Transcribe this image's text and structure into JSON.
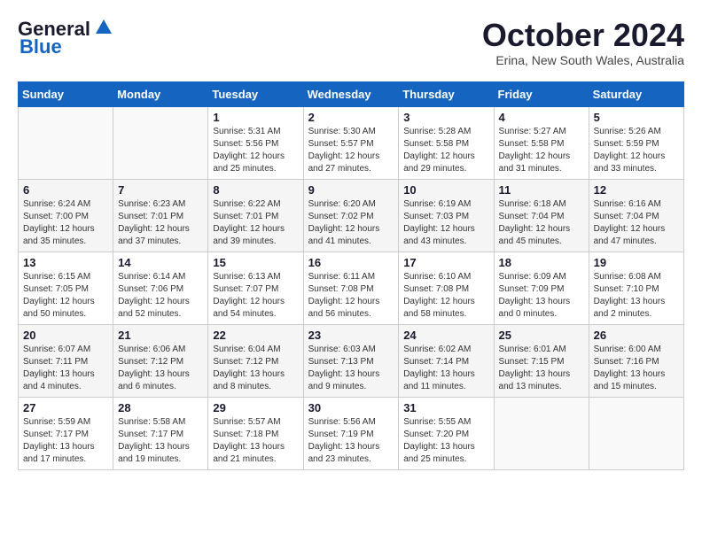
{
  "header": {
    "logo_general": "General",
    "logo_blue": "Blue",
    "month": "October 2024",
    "location": "Erina, New South Wales, Australia"
  },
  "days_of_week": [
    "Sunday",
    "Monday",
    "Tuesday",
    "Wednesday",
    "Thursday",
    "Friday",
    "Saturday"
  ],
  "weeks": [
    [
      {
        "day": "",
        "info": ""
      },
      {
        "day": "",
        "info": ""
      },
      {
        "day": "1",
        "info": "Sunrise: 5:31 AM\nSunset: 5:56 PM\nDaylight: 12 hours\nand 25 minutes."
      },
      {
        "day": "2",
        "info": "Sunrise: 5:30 AM\nSunset: 5:57 PM\nDaylight: 12 hours\nand 27 minutes."
      },
      {
        "day": "3",
        "info": "Sunrise: 5:28 AM\nSunset: 5:58 PM\nDaylight: 12 hours\nand 29 minutes."
      },
      {
        "day": "4",
        "info": "Sunrise: 5:27 AM\nSunset: 5:58 PM\nDaylight: 12 hours\nand 31 minutes."
      },
      {
        "day": "5",
        "info": "Sunrise: 5:26 AM\nSunset: 5:59 PM\nDaylight: 12 hours\nand 33 minutes."
      }
    ],
    [
      {
        "day": "6",
        "info": "Sunrise: 6:24 AM\nSunset: 7:00 PM\nDaylight: 12 hours\nand 35 minutes."
      },
      {
        "day": "7",
        "info": "Sunrise: 6:23 AM\nSunset: 7:01 PM\nDaylight: 12 hours\nand 37 minutes."
      },
      {
        "day": "8",
        "info": "Sunrise: 6:22 AM\nSunset: 7:01 PM\nDaylight: 12 hours\nand 39 minutes."
      },
      {
        "day": "9",
        "info": "Sunrise: 6:20 AM\nSunset: 7:02 PM\nDaylight: 12 hours\nand 41 minutes."
      },
      {
        "day": "10",
        "info": "Sunrise: 6:19 AM\nSunset: 7:03 PM\nDaylight: 12 hours\nand 43 minutes."
      },
      {
        "day": "11",
        "info": "Sunrise: 6:18 AM\nSunset: 7:04 PM\nDaylight: 12 hours\nand 45 minutes."
      },
      {
        "day": "12",
        "info": "Sunrise: 6:16 AM\nSunset: 7:04 PM\nDaylight: 12 hours\nand 47 minutes."
      }
    ],
    [
      {
        "day": "13",
        "info": "Sunrise: 6:15 AM\nSunset: 7:05 PM\nDaylight: 12 hours\nand 50 minutes."
      },
      {
        "day": "14",
        "info": "Sunrise: 6:14 AM\nSunset: 7:06 PM\nDaylight: 12 hours\nand 52 minutes."
      },
      {
        "day": "15",
        "info": "Sunrise: 6:13 AM\nSunset: 7:07 PM\nDaylight: 12 hours\nand 54 minutes."
      },
      {
        "day": "16",
        "info": "Sunrise: 6:11 AM\nSunset: 7:08 PM\nDaylight: 12 hours\nand 56 minutes."
      },
      {
        "day": "17",
        "info": "Sunrise: 6:10 AM\nSunset: 7:08 PM\nDaylight: 12 hours\nand 58 minutes."
      },
      {
        "day": "18",
        "info": "Sunrise: 6:09 AM\nSunset: 7:09 PM\nDaylight: 13 hours\nand 0 minutes."
      },
      {
        "day": "19",
        "info": "Sunrise: 6:08 AM\nSunset: 7:10 PM\nDaylight: 13 hours\nand 2 minutes."
      }
    ],
    [
      {
        "day": "20",
        "info": "Sunrise: 6:07 AM\nSunset: 7:11 PM\nDaylight: 13 hours\nand 4 minutes."
      },
      {
        "day": "21",
        "info": "Sunrise: 6:06 AM\nSunset: 7:12 PM\nDaylight: 13 hours\nand 6 minutes."
      },
      {
        "day": "22",
        "info": "Sunrise: 6:04 AM\nSunset: 7:12 PM\nDaylight: 13 hours\nand 8 minutes."
      },
      {
        "day": "23",
        "info": "Sunrise: 6:03 AM\nSunset: 7:13 PM\nDaylight: 13 hours\nand 9 minutes."
      },
      {
        "day": "24",
        "info": "Sunrise: 6:02 AM\nSunset: 7:14 PM\nDaylight: 13 hours\nand 11 minutes."
      },
      {
        "day": "25",
        "info": "Sunrise: 6:01 AM\nSunset: 7:15 PM\nDaylight: 13 hours\nand 13 minutes."
      },
      {
        "day": "26",
        "info": "Sunrise: 6:00 AM\nSunset: 7:16 PM\nDaylight: 13 hours\nand 15 minutes."
      }
    ],
    [
      {
        "day": "27",
        "info": "Sunrise: 5:59 AM\nSunset: 7:17 PM\nDaylight: 13 hours\nand 17 minutes."
      },
      {
        "day": "28",
        "info": "Sunrise: 5:58 AM\nSunset: 7:17 PM\nDaylight: 13 hours\nand 19 minutes."
      },
      {
        "day": "29",
        "info": "Sunrise: 5:57 AM\nSunset: 7:18 PM\nDaylight: 13 hours\nand 21 minutes."
      },
      {
        "day": "30",
        "info": "Sunrise: 5:56 AM\nSunset: 7:19 PM\nDaylight: 13 hours\nand 23 minutes."
      },
      {
        "day": "31",
        "info": "Sunrise: 5:55 AM\nSunset: 7:20 PM\nDaylight: 13 hours\nand 25 minutes."
      },
      {
        "day": "",
        "info": ""
      },
      {
        "day": "",
        "info": ""
      }
    ]
  ]
}
